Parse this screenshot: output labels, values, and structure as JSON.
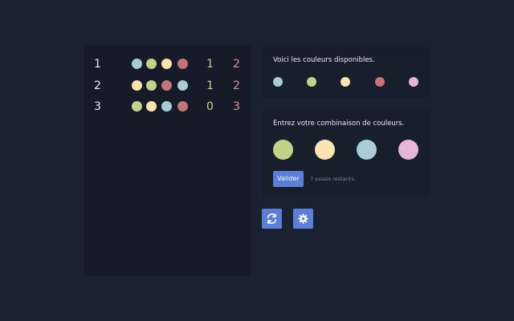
{
  "colors": {
    "blue": "#a8cdd7",
    "green": "#bfd486",
    "yellow": "#fde3b0",
    "red": "#c47477",
    "pink": "#e7b5d6",
    "score_good": "#c2d68a",
    "score_misplaced": "#e08f9c",
    "accent": "#5b7fd6"
  },
  "history": [
    {
      "number": "1",
      "pegs": [
        "blue",
        "green",
        "yellow",
        "red"
      ],
      "good": "1",
      "misplaced": "2"
    },
    {
      "number": "2",
      "pegs": [
        "yellow",
        "green",
        "red",
        "blue"
      ],
      "good": "1",
      "misplaced": "2"
    },
    {
      "number": "3",
      "pegs": [
        "green",
        "yellow",
        "blue",
        "red"
      ],
      "good": "0",
      "misplaced": "3"
    }
  ],
  "available": {
    "title": "Voici les couleurs disponibles.",
    "pegs": [
      "blue",
      "green",
      "yellow",
      "red",
      "pink"
    ]
  },
  "input": {
    "title": "Entrez votre combinaison de couleurs.",
    "pegs": [
      "green",
      "yellow",
      "blue",
      "pink"
    ],
    "validate_label": "Valider",
    "tries_text": "7 essais restants."
  },
  "actions": {
    "restart_icon": "refresh-icon",
    "settings_icon": "gear-icon"
  }
}
